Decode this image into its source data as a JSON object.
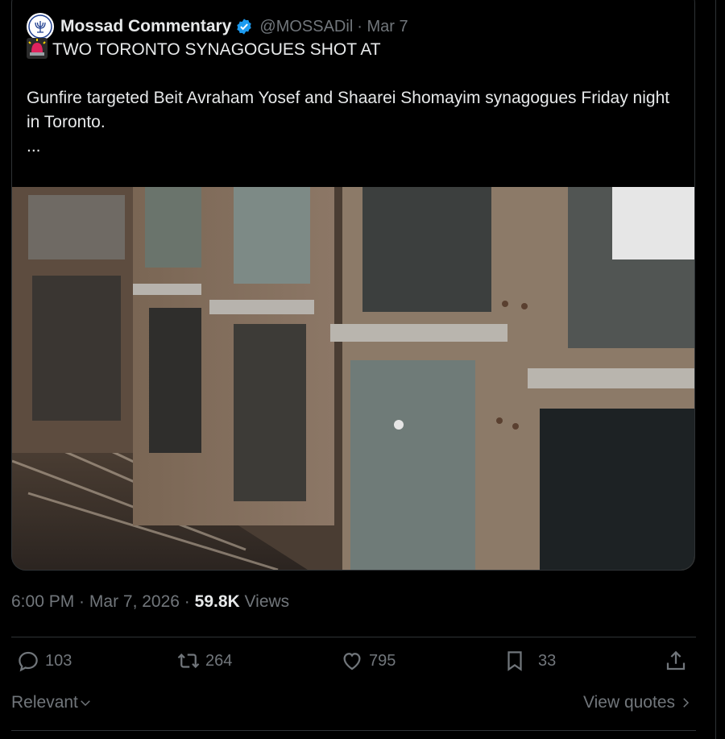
{
  "quote": {
    "author_name": "Mossad Commentary",
    "handle": "@MOSSADil",
    "date": "· Mar 7",
    "headline": "TWO TORONTO SYNAGOGUES SHOT AT",
    "body": "Gunfire targeted Beit Avraham Yosef and Shaarei Shomayim synagogues Friday night in Toronto.",
    "more": "..."
  },
  "meta": {
    "time": "6:00 PM",
    "sep1": " · ",
    "date": "Mar 7, 2026",
    "sep2": " · ",
    "views_count": "59.8K",
    "views_label": " Views"
  },
  "actions": {
    "replies": "103",
    "reposts": "264",
    "likes": "795",
    "bookmarks": "33"
  },
  "footer": {
    "relevant": "Relevant",
    "view_quotes": "View quotes"
  },
  "colors": {
    "background": "#000000",
    "text": "#e7e9ea",
    "muted": "#71767b",
    "verified": "#1d9bf0",
    "border": "#2f3336"
  },
  "icons": [
    "verified-badge-icon",
    "siren-icon",
    "reply-icon",
    "repost-icon",
    "like-icon",
    "bookmark-icon",
    "share-icon",
    "chevron-down-icon",
    "chevron-right-icon"
  ]
}
